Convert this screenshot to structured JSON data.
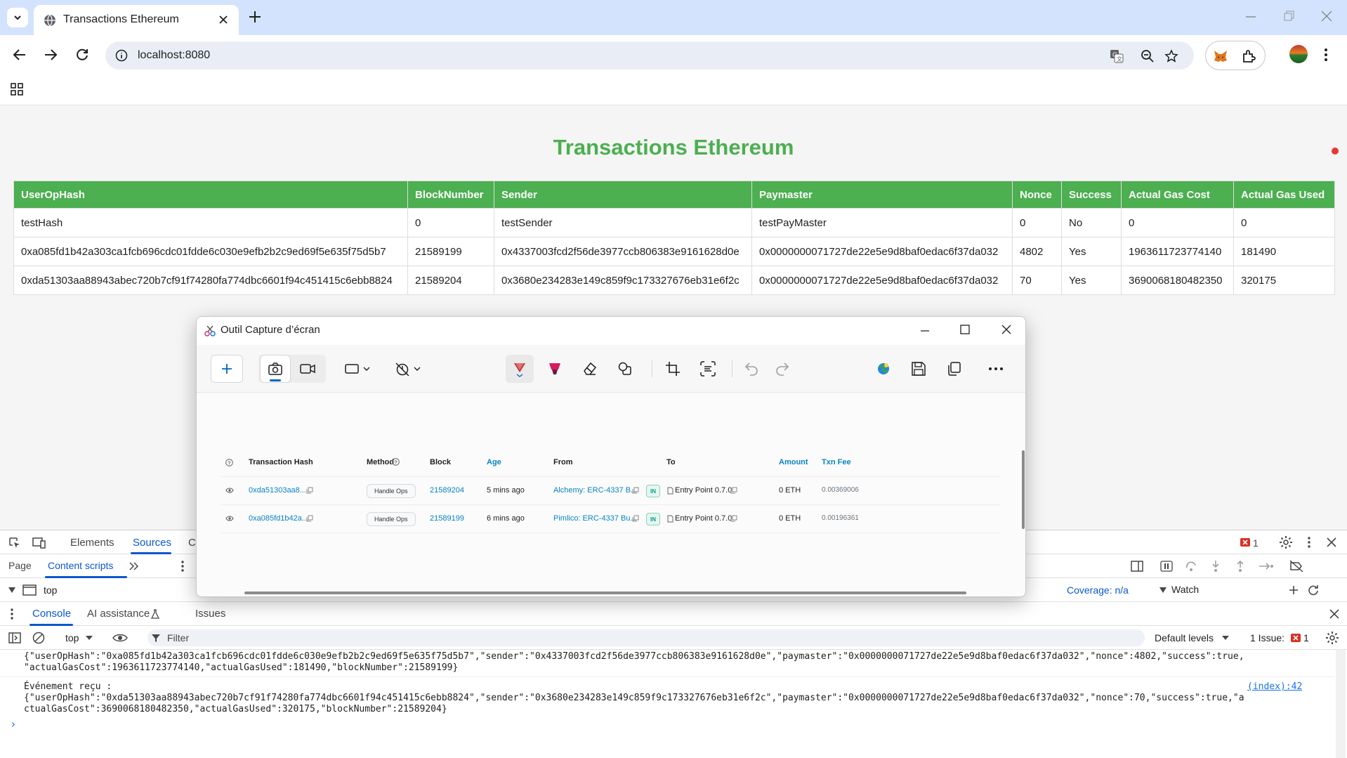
{
  "browser": {
    "tab_title": "Transactions Ethereum",
    "url": "localhost:8080"
  },
  "page": {
    "title": "Transactions Ethereum",
    "table": {
      "headers": [
        "UserOpHash",
        "BlockNumber",
        "Sender",
        "Paymaster",
        "Nonce",
        "Success",
        "Actual Gas Cost",
        "Actual Gas Used"
      ],
      "rows": [
        [
          "testHash",
          "0",
          "testSender",
          "testPayMaster",
          "0",
          "No",
          "0",
          "0"
        ],
        [
          "0xa085fd1b42a303ca1fcb696cdc01fdde6c030e9efb2b2c9ed69f5e635f75d5b7",
          "21589199",
          "0x4337003fcd2f56de3977ccb806383e9161628d0e",
          "0x0000000071727de22e5e9d8baf0edac6f37da032",
          "4802",
          "Yes",
          "1963611723774140",
          "181490"
        ],
        [
          "0xda51303aa88943abec720b7cf91f74280fa774dbc6601f94c451415c6ebb8824",
          "21589204",
          "0x3680e234283e149c859f9c173327676eb31e6f2c",
          "0x0000000071727de22e5e9d8baf0edac6f37da032",
          "70",
          "Yes",
          "3690068180482350",
          "320175"
        ]
      ]
    }
  },
  "snipping_tool": {
    "title": "Outil Capture d’écran",
    "capture": {
      "headers": [
        "Transaction Hash",
        "Method",
        "Block",
        "Age",
        "From",
        "To",
        "Amount",
        "Txn Fee"
      ],
      "rows": [
        {
          "hash": "0xda51303aa8...",
          "method": "Handle Ops",
          "block": "21589204",
          "age": "5 mins ago",
          "from": "Alchemy: ERC-4337 B...",
          "dir": "IN",
          "to": "Entry Point 0.7.0",
          "amount": "0 ETH",
          "fee": "0.00369006"
        },
        {
          "hash": "0xa085fd1b42a...",
          "method": "Handle Ops",
          "block": "21589199",
          "age": "6 mins ago",
          "from": "Pimlico: ERC-4337 Bu...",
          "dir": "IN",
          "to": "Entry Point 0.7.0",
          "amount": "0 ETH",
          "fee": "0.00196361"
        }
      ]
    }
  },
  "devtools": {
    "tabs": [
      "Elements",
      "Sources"
    ],
    "tab_partial": "C",
    "error_count": "1",
    "sub_tabs": [
      "Page",
      "Content scripts"
    ],
    "tree_top": "top",
    "coverage": "Coverage: n/a",
    "watch": "Watch",
    "drawer_tabs": [
      "Console",
      "AI assistance",
      "Issues"
    ],
    "context": "top",
    "filter_placeholder": "Filter",
    "levels": "Default levels",
    "issues": "1 Issue:",
    "issues_count": "1",
    "console_lines": [
      "{\"userOpHash\":\"0xa085fd1b42a303ca1fcb696cdc01fdde6c030e9efb2b2c9ed69f5e635f75d5b7\",\"sender\":\"0x4337003fcd2f56de3977ccb806383e9161628d0e\",\"paymaster\":\"0x0000000071727de22e5e9d8baf0edac6f37da032\",\"nonce\":4802,\"success\":true,",
      "\"actualGasCost\":1963611723774140,\"actualGasUsed\":181490,\"blockNumber\":21589199}",
      "Événement reçu :",
      "{\"userOpHash\":\"0xda51303aa88943abec720b7cf91f74280fa774dbc6601f94c451415c6ebb8824\",\"sender\":\"0x3680e234283e149c859f9c173327676eb31e6f2c\",\"paymaster\":\"0x0000000071727de22e5e9d8baf0edac6f37da032\",\"nonce\":70,\"success\":true,\"a",
      "ctualGasCost\":3690068180482350,\"actualGasUsed\":320175,\"blockNumber\":21589204}"
    ],
    "source_link": "(index):42",
    "prompt": "›"
  },
  "colors": {
    "accent_green": "#4caf50",
    "link_blue": "#0784c3",
    "devtools_blue": "#0b57d0",
    "error_red": "#d93025"
  }
}
